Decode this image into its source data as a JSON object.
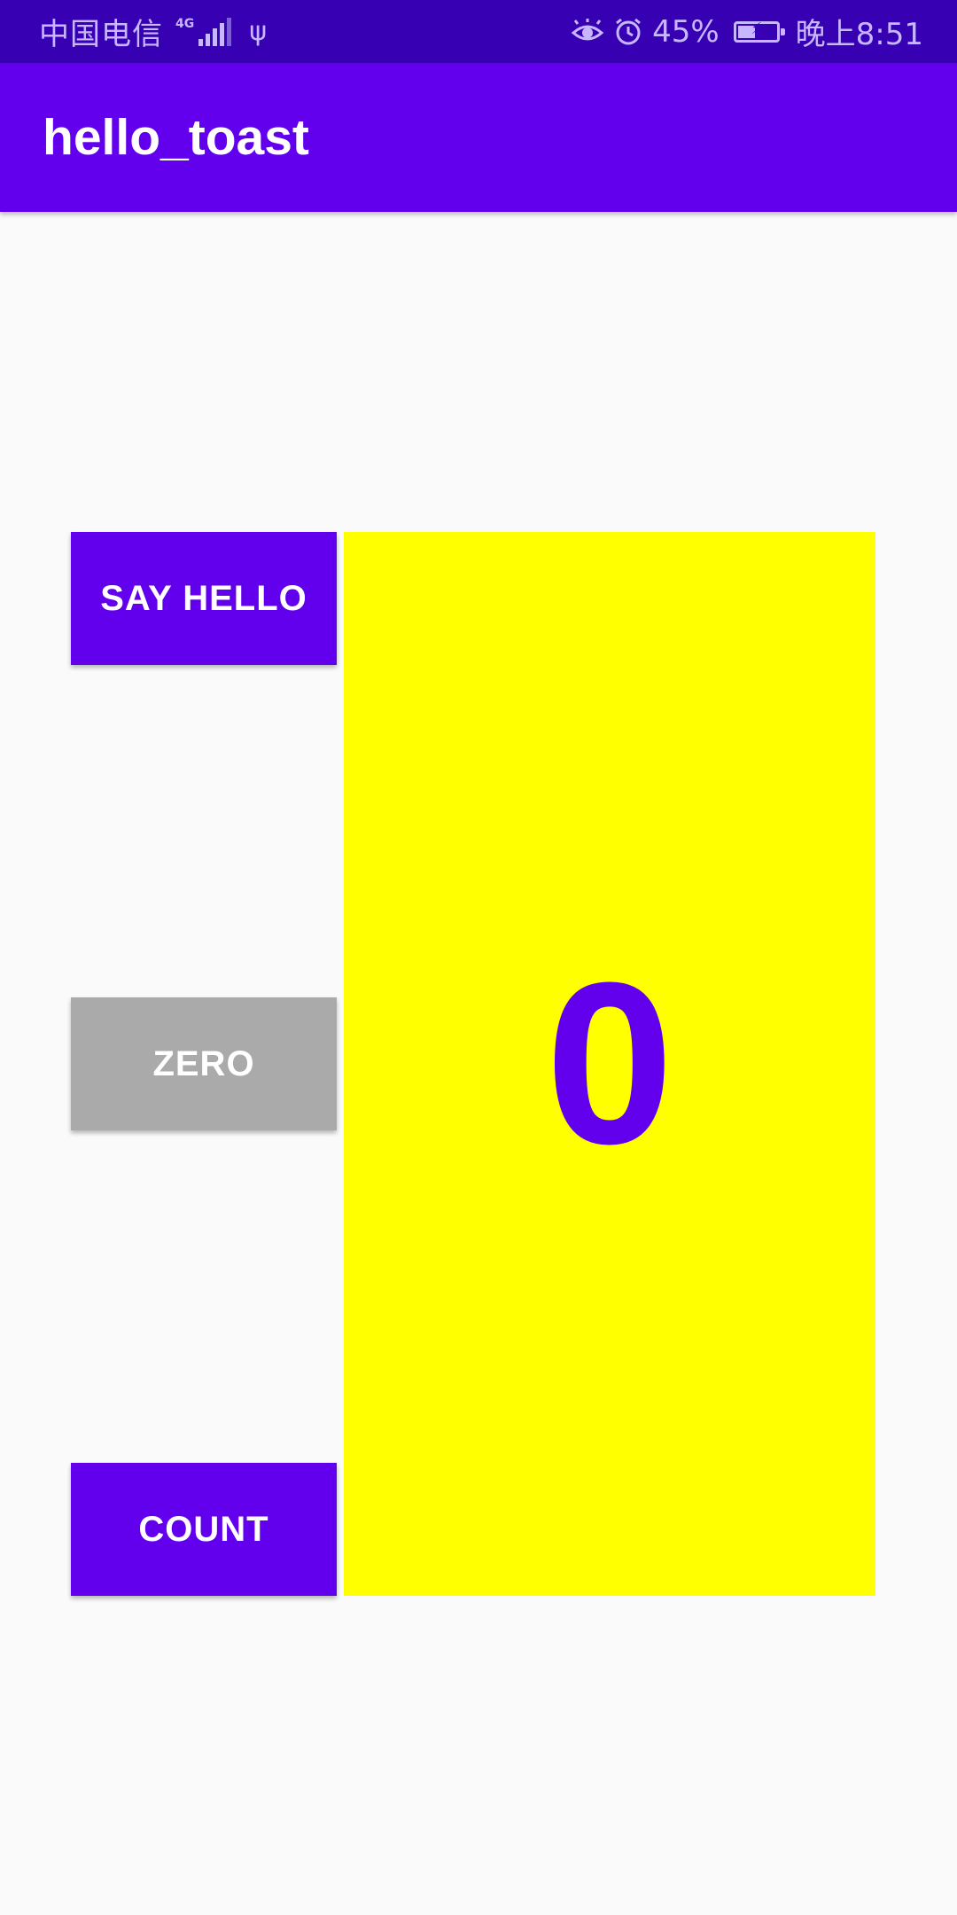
{
  "status_bar": {
    "carrier": "中国电信",
    "network": "4G",
    "battery_percent": "45%",
    "battery_level": 0.45,
    "time": "晚上8:51",
    "icons": [
      "signal-icon",
      "usb-icon",
      "eye-comfort-icon",
      "alarm-icon",
      "battery-charging-icon"
    ]
  },
  "app_bar": {
    "title": "hello_toast"
  },
  "buttons": {
    "say_hello": "SAY HELLO",
    "zero": "ZERO",
    "count": "COUNT"
  },
  "counter": {
    "value": "0"
  },
  "colors": {
    "status_bar": "#3700b3",
    "primary": "#6200ee",
    "zero_button": "#aaaaaa",
    "counter_background": "#ffff00",
    "counter_text": "#6200ee"
  }
}
